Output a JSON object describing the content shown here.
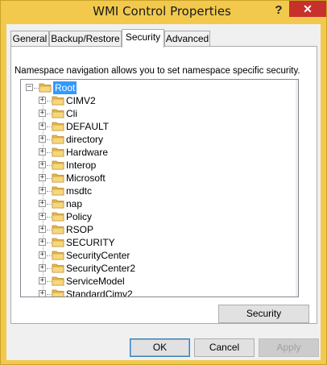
{
  "window": {
    "title": "WMI Control Properties",
    "help_label": "?",
    "close_label": "✕"
  },
  "tabs": [
    {
      "label": "General"
    },
    {
      "label": "Backup/Restore"
    },
    {
      "label": "Security"
    },
    {
      "label": "Advanced"
    }
  ],
  "active_tab": "Security",
  "security": {
    "description": "Namespace navigation allows you to set namespace specific security.",
    "tree": {
      "root": "Root",
      "children": [
        "CIMV2",
        "Cli",
        "DEFAULT",
        "directory",
        "Hardware",
        "Interop",
        "Microsoft",
        "msdtc",
        "nap",
        "Policy",
        "RSOP",
        "SECURITY",
        "SecurityCenter",
        "SecurityCenter2",
        "ServiceModel",
        "StandardCimv2"
      ],
      "expander_collapsed": "+",
      "expander_expanded": "−"
    },
    "security_button": "Security"
  },
  "buttons": {
    "ok": "OK",
    "cancel": "Cancel",
    "apply": "Apply"
  },
  "colors": {
    "titlebar": "#f2c94c",
    "close": "#c7302b",
    "selection": "#3399ff",
    "folder": "#e8b84a"
  }
}
